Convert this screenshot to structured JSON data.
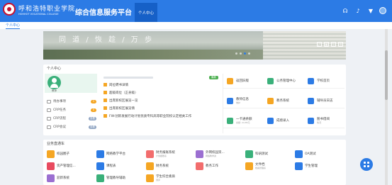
{
  "header": {
    "logo_cn": "呼和浩特职业学院",
    "logo_en": "HOHHOT VOCATIONAL COLLEGE",
    "title": "综合信息服务平台",
    "active_tab": "个人中心",
    "icons": [
      "headset-icon",
      "volume-icon",
      "tshirt-icon",
      "avatar"
    ]
  },
  "breadcrumb": "个人中心",
  "banner": {
    "text": "同 道 / 恢 趁 / 万 歩"
  },
  "personal": {
    "title": "个人中心",
    "role": "教师",
    "stats": [
      {
        "label": "待办事项",
        "badge": "1",
        "color": "#f5a623"
      },
      {
        "label": "CRP任务",
        "badge": "0",
        "color": "#f5a623"
      },
      {
        "label": "CRP流程",
        "badge": "查看",
        "color": "#8fa4c2"
      },
      {
        "label": "CRP会议",
        "badge": "查看",
        "color": "#8fa4c2"
      }
    ],
    "news_tag": "最新",
    "news": [
      "岗位聘书详情",
      "超级岗位（正县级）",
      "出席新校区展览一览",
      "出席新校区展览情",
      "FW:创新发展行动计划优质专科高等职业院校认定相关工作"
    ]
  },
  "right_apps": [
    {
      "label": "返回旧版",
      "sub": "",
      "color": "#f5a623",
      "icon": "home-icon"
    },
    {
      "label": "公务管理中心",
      "sub": "",
      "color": "#3ab07a",
      "icon": "gear-icon"
    },
    {
      "label": "学校首页",
      "sub": "",
      "color": "#2c7be5",
      "icon": "home-icon"
    },
    {
      "label": "教师信息",
      "sub": "维护",
      "color": "#2c7be5",
      "icon": "user-icon"
    },
    {
      "label": "教务系统",
      "sub": "",
      "color": "#f5a623",
      "icon": "book-icon"
    },
    {
      "label": "辅导员日志",
      "sub": "",
      "color": "#2c7be5",
      "icon": "note-icon"
    },
    {
      "label": "一卡通余额",
      "sub": "余额: 24.85元",
      "color": "#3ab07a",
      "icon": "card-icon"
    },
    {
      "label": "成绩录入",
      "sub": "",
      "color": "#2c7be5",
      "icon": "edit-icon"
    },
    {
      "label": "图书借阅",
      "sub": "情况",
      "color": "#2c7be5",
      "icon": "library-icon"
    }
  ],
  "quick": {
    "title": "业务直通车",
    "items": [
      {
        "label": "校园圈子",
        "sub": "",
        "color": "#f5a623",
        "icon": "circle-icon"
      },
      {
        "label": "网络教学平台",
        "sub": "",
        "color": "#2c7be5",
        "icon": "screen-icon"
      },
      {
        "label": "财务报账系统",
        "sub": "计划报账系",
        "color": "#f26d6d",
        "icon": "finance-icon"
      },
      {
        "label": "外网校园资...",
        "sub": "网络教学资",
        "color": "#9b6fd1",
        "icon": "globe-icon"
      },
      {
        "label": "科研测试",
        "sub": "",
        "color": "#3ab07a",
        "icon": "flask-icon"
      },
      {
        "label": "OA测试",
        "sub": "",
        "color": "#2c7be5",
        "icon": "oa-icon"
      },
      {
        "label": "资产管理信...",
        "sub": "",
        "color": "#e84a5f",
        "icon": "asset-icon"
      },
      {
        "label": "课程表",
        "sub": "",
        "color": "#2c7be5",
        "icon": "calendar-icon"
      },
      {
        "label": "财务系统",
        "sub": "",
        "color": "#f5a623",
        "icon": "finance-icon"
      },
      {
        "label": "教务工作",
        "sub": "",
        "color": "#f26d6d",
        "icon": "book-icon"
      },
      {
        "label": "文件档",
        "sub": "档案管理系",
        "color": "#f5a623",
        "icon": "folder-icon"
      },
      {
        "label": "学生管理",
        "sub": "",
        "color": "#2c7be5",
        "icon": "student-icon"
      },
      {
        "label": "迎新系统",
        "sub": "",
        "color": "#9b6fd1",
        "icon": "welcome-icon"
      },
      {
        "label": "管理教导辅助",
        "sub": "",
        "color": "#3ab07a",
        "icon": "assist-icon"
      },
      {
        "label": "学生综合素质",
        "sub": "测评",
        "color": "#f5a623",
        "icon": "quality-icon"
      }
    ]
  }
}
